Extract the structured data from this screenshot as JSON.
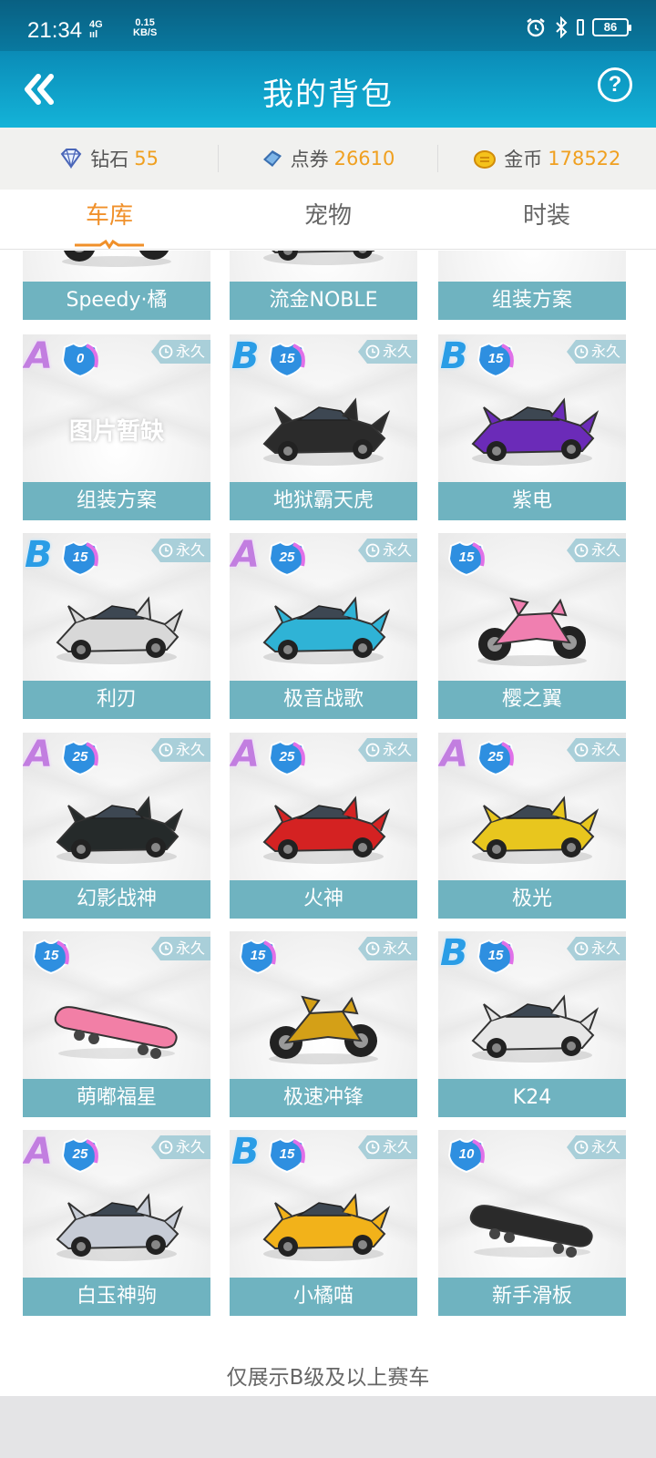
{
  "status_bar": {
    "time": "21:34",
    "network": "4G",
    "network_sub": "ııl",
    "speed_value": "0.15",
    "speed_unit": "KB/S",
    "battery": "86"
  },
  "header": {
    "title": "我的背包"
  },
  "currencies": [
    {
      "label": "钻石",
      "value": "55",
      "icon": "diamond-icon"
    },
    {
      "label": "点券",
      "value": "26610",
      "icon": "coupon-icon"
    },
    {
      "label": "金币",
      "value": "178522",
      "icon": "gold-coin-icon"
    }
  ],
  "tabs": [
    {
      "label": "车库",
      "active": true
    },
    {
      "label": "宠物",
      "active": false
    },
    {
      "label": "时装",
      "active": false
    }
  ],
  "garage": {
    "items": [
      {
        "name": "Speedy·橘",
        "grade": "",
        "level": "",
        "duration": "",
        "kind": "bike",
        "color": "#c9c9c9"
      },
      {
        "name": "流金NOBLE",
        "grade": "",
        "level": "",
        "duration": "",
        "kind": "car",
        "color": "#bfbfbf"
      },
      {
        "name": "组装方案",
        "grade": "",
        "level": "",
        "duration": "",
        "kind": "none",
        "color": "#cccccc"
      },
      {
        "name": "组装方案",
        "grade": "A",
        "level": "0",
        "duration": "永久",
        "kind": "placeholder",
        "color": "#cccccc",
        "placeholder_text": "图片暂缺"
      },
      {
        "name": "地狱霸天虎",
        "grade": "B",
        "level": "15",
        "duration": "永久",
        "kind": "car",
        "color": "#2b2b2b"
      },
      {
        "name": "紫电",
        "grade": "B",
        "level": "15",
        "duration": "永久",
        "kind": "car",
        "color": "#6b2bb8"
      },
      {
        "name": "利刃",
        "grade": "B",
        "level": "15",
        "duration": "永久",
        "kind": "car",
        "color": "#d8d8d8"
      },
      {
        "name": "极音战歌",
        "grade": "A",
        "level": "25",
        "duration": "永久",
        "kind": "car",
        "color": "#2fb3d6"
      },
      {
        "name": "樱之翼",
        "grade": "",
        "level": "15",
        "duration": "永久",
        "kind": "bike",
        "color": "#f07fb0"
      },
      {
        "name": "幻影战神",
        "grade": "A",
        "level": "25",
        "duration": "永久",
        "kind": "car",
        "color": "#252a2a"
      },
      {
        "name": "火神",
        "grade": "A",
        "level": "25",
        "duration": "永久",
        "kind": "car",
        "color": "#d42222"
      },
      {
        "name": "极光",
        "grade": "A",
        "level": "25",
        "duration": "永久",
        "kind": "car",
        "color": "#e8c61e"
      },
      {
        "name": "萌嘟福星",
        "grade": "",
        "level": "15",
        "duration": "永久",
        "kind": "board",
        "color": "#f27fa6"
      },
      {
        "name": "极速冲锋",
        "grade": "",
        "level": "15",
        "duration": "永久",
        "kind": "bike",
        "color": "#d4a017"
      },
      {
        "name": "K24",
        "grade": "B",
        "level": "15",
        "duration": "永久",
        "kind": "car",
        "color": "#e6e6e6"
      },
      {
        "name": "白玉神驹",
        "grade": "A",
        "level": "25",
        "duration": "永久",
        "kind": "car",
        "color": "#c7ccd6"
      },
      {
        "name": "小橘喵",
        "grade": "B",
        "level": "15",
        "duration": "永久",
        "kind": "car",
        "color": "#f2b21a"
      },
      {
        "name": "新手滑板",
        "grade": "",
        "level": "10",
        "duration": "永久",
        "kind": "board",
        "color": "#2a2a2a"
      }
    ]
  },
  "footer_note": "仅展示B级及以上赛车",
  "colors": {
    "accent_orange": "#f0902a",
    "currency_value": "#f0a020",
    "name_bar": "#6fb3c0",
    "header_blue": "#0b8fba"
  }
}
